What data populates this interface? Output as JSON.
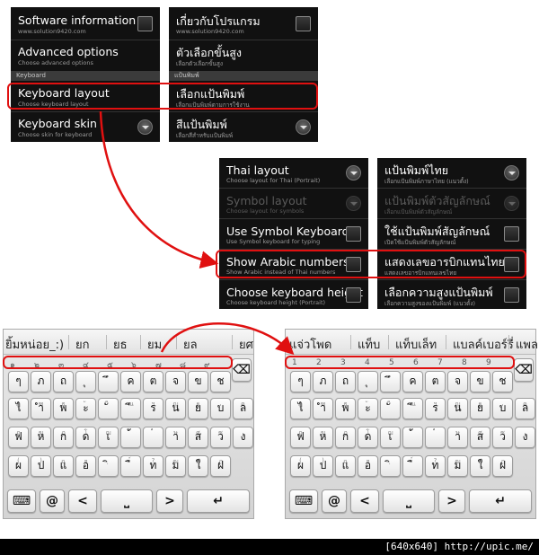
{
  "colors": {
    "panel_bg": "#111111",
    "highlight": "#e01010",
    "footer_bg": "#000000"
  },
  "settings_en": {
    "rows": [
      {
        "title": "Software information",
        "subtitle": "www.solution9420.com",
        "control": "checkbox"
      },
      {
        "title": "Advanced options",
        "subtitle": "Choose advanced options",
        "control": "none"
      },
      {
        "title": "Keyboard layout",
        "subtitle": "Choose keyboard layout",
        "control": "none"
      },
      {
        "title": "Keyboard skin",
        "subtitle": "Choose skin for keyboard",
        "control": "dropdown"
      }
    ],
    "category": "Keyboard"
  },
  "settings_th": {
    "rows": [
      {
        "title": "เกี่ยวกับโปรแกรม",
        "subtitle": "www.solution9420.com",
        "control": "checkbox"
      },
      {
        "title": "ตัวเลือกขั้นสูง",
        "subtitle": "เลือกตัวเลือกขั้นสูง",
        "control": "none"
      },
      {
        "title": "เลือกแป้นพิมพ์",
        "subtitle": "เลือกแป้นพิมพ์ตามการใช้งาน",
        "control": "none"
      },
      {
        "title": "สีแป้นพิมพ์",
        "subtitle": "เลือกสีสำหรับแป้นพิมพ์",
        "control": "dropdown"
      }
    ],
    "category": "แป้นพิมพ์"
  },
  "layout_en": {
    "rows": [
      {
        "title": "Thai layout",
        "subtitle": "Choose layout for Thai (Portrait)",
        "control": "dropdown",
        "enabled": true
      },
      {
        "title": "Symbol layout",
        "subtitle": "Choose layout for symbols",
        "control": "dropdown",
        "enabled": false
      },
      {
        "title": "Use Symbol Keyboard",
        "subtitle": "Use Symbol keyboard for typing",
        "control": "checkbox",
        "enabled": true
      },
      {
        "title": "Show Arabic numbers",
        "subtitle": "Show Arabic instead of Thai numbers",
        "control": "checkbox",
        "enabled": true
      },
      {
        "title": "Choose keyboard height",
        "subtitle": "Choose keyboard height (Portrait)",
        "control": "checkbox",
        "enabled": true
      }
    ]
  },
  "layout_th": {
    "rows": [
      {
        "title": "แป้นพิมพ์ไทย",
        "subtitle": "เลือกแป้นพิมพ์ภาษาไทย (แนวตั้ง)",
        "control": "dropdown",
        "enabled": true
      },
      {
        "title": "แป้นพิมพ์ตัวสัญลักษณ์",
        "subtitle": "เลือกแป้นพิมพ์ตัวสัญลักษณ์",
        "control": "dropdown",
        "enabled": false
      },
      {
        "title": "ใช้แป้นพิมพ์สัญลักษณ์",
        "subtitle": "เปิดใช้แป้นพิมพ์ตัวสัญลักษณ์",
        "control": "checkbox",
        "enabled": true
      },
      {
        "title": "แสดงเลขอารบิกแทนไทย",
        "subtitle": "แสดงเลขอารบิกแทนเลขไทย",
        "control": "checkbox",
        "enabled": true
      },
      {
        "title": "เลือกความสูงแป้นพิมพ์",
        "subtitle": "เลือกความสูงของแป้นพิมพ์ (แนวตั้ง)",
        "control": "checkbox",
        "enabled": true
      }
    ]
  },
  "keyboard_left": {
    "candidates": [
      "ยิ้มหน่อย_:)",
      "ยก",
      "ยธ",
      "ยม",
      "ยล",
      "ยศ"
    ],
    "numbers": [
      "๑",
      "๒",
      "๓",
      "๔",
      "๕",
      "๖",
      "๗",
      "๘",
      "๙"
    ]
  },
  "keyboard_right": {
    "candidates": [
      "แจ่วโพด",
      "แท็บ",
      "แท็บเล็ท",
      "แบลค์เบอร์รี่",
      "แพล"
    ],
    "numbers": [
      "1",
      "2",
      "3",
      "4",
      "5",
      "6",
      "7",
      "8",
      "9"
    ]
  },
  "keys": {
    "row1": [
      {
        "top": "",
        "main": "ๆ"
      },
      {
        "top": "",
        "main": "ภ"
      },
      {
        "top": "",
        "main": "ถ"
      },
      {
        "top": "",
        "main": "ุ"
      },
      {
        "top": "",
        "main": "ึ"
      },
      {
        "top": "",
        "main": "ค"
      },
      {
        "top": "",
        "main": "ต"
      },
      {
        "top": "",
        "main": "จ"
      },
      {
        "top": "",
        "main": "ข"
      },
      {
        "top": "",
        "main": "ช"
      }
    ],
    "row2": [
      {
        "top": "ฎ",
        "main": "ไ"
      },
      {
        "top": "ฑ",
        "main": "ำ"
      },
      {
        "top": "ธ",
        "main": "พ"
      },
      {
        "top": "ั",
        "main": "ะ"
      },
      {
        "top": "ี",
        "main": "ั"
      },
      {
        "top": "ณ",
        "main": "ี"
      },
      {
        "top": "ฯ",
        "main": "ร"
      },
      {
        "top": "ญ",
        "main": "น"
      },
      {
        "top": "ฐ",
        "main": "ย"
      },
      {
        "top": ",",
        "main": "บ"
      },
      {
        "top": "ฅ",
        "main": "ล"
      }
    ],
    "row3": [
      {
        "top": "ฤ",
        "main": "ฟ"
      },
      {
        "top": "ฆ",
        "main": "ห"
      },
      {
        "top": "ฏ",
        "main": "ก"
      },
      {
        "top": "โ",
        "main": "ด"
      },
      {
        "top": "ฌ",
        "main": "เ"
      },
      {
        "top": "็",
        "main": "้"
      },
      {
        "top": "๋",
        "main": "่"
      },
      {
        "top": "ษ",
        "main": "า"
      },
      {
        "top": "ศ",
        "main": "ส"
      },
      {
        "top": "ซ",
        "main": "ว"
      },
      {
        "top": ".",
        "main": "ง"
      }
    ],
    "row4": [
      {
        "top": "(",
        "main": "ผ"
      },
      {
        "top": ")",
        "main": "ป"
      },
      {
        "top": "ฉ",
        "main": "แ"
      },
      {
        "top": "ฮ",
        "main": "อ"
      },
      {
        "top": "ฺ",
        "main": "ิ"
      },
      {
        "top": "์",
        "main": "ื"
      },
      {
        "top": "?",
        "main": "ท"
      },
      {
        "top": "ฒ",
        "main": "ม"
      },
      {
        "top": "ฬ",
        "main": "ใ"
      },
      {
        "top": "ฦ",
        "main": "ฝ"
      }
    ],
    "bottom": [
      {
        "name": "keyboard-icon",
        "label": "⌨"
      },
      {
        "name": "at-key",
        "label": "@"
      },
      {
        "name": "left-arrow-key",
        "label": "<"
      },
      {
        "name": "space-key",
        "label": "⎵"
      },
      {
        "name": "right-arrow-key",
        "label": ">"
      },
      {
        "name": "enter-key",
        "label": "↵"
      }
    ],
    "backspace": "⌫"
  },
  "footer": "[640x640] http://upic.me/"
}
